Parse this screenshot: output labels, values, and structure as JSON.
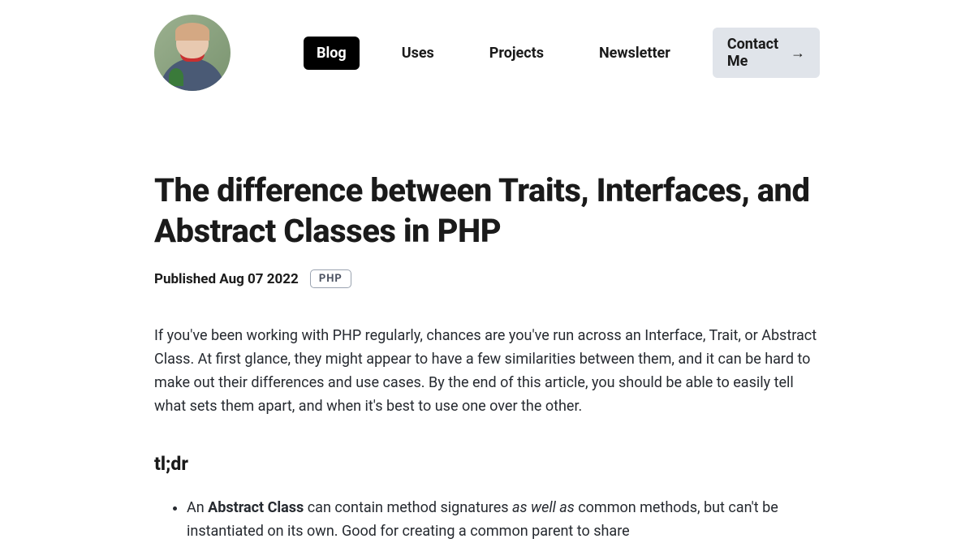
{
  "nav": {
    "items": [
      {
        "label": "Blog",
        "active": true
      },
      {
        "label": "Uses",
        "active": false
      },
      {
        "label": "Projects",
        "active": false
      },
      {
        "label": "Newsletter",
        "active": false
      }
    ],
    "contact_label": "Contact Me",
    "contact_arrow": "→"
  },
  "article": {
    "title": "The difference between Traits, Interfaces, and Abstract Classes in PHP",
    "published_label": "Published Aug 07 2022",
    "tag": "PHP",
    "intro": "If you've been working with PHP regularly, chances are you've run across an Interface, Trait, or Abstract Class. At first glance, they might appear to have a few similarities between them, and it can be hard to make out their differences and use cases. By the end of this article, you should be able to easily tell what sets them apart, and when it's best to use one over the other.",
    "tldr_heading": "tl;dr",
    "tldr": {
      "item1_prefix": "An ",
      "item1_bold": "Abstract Class",
      "item1_mid": " can contain method signatures ",
      "item1_italic": "as well as",
      "item1_suffix": " common methods, but can't be instantiated on its own. Good for creating a common parent to share"
    }
  }
}
